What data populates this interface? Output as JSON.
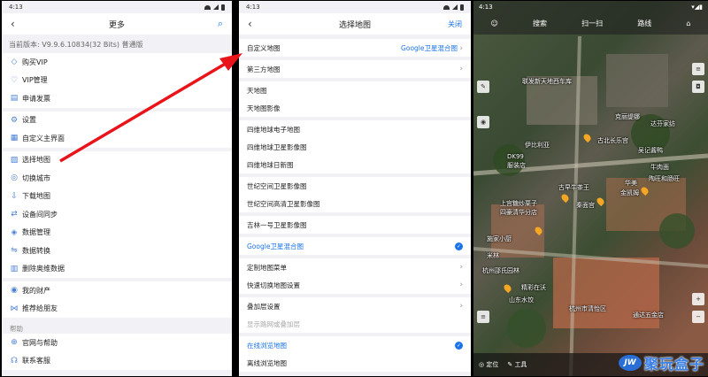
{
  "left": {
    "time": "4:13",
    "title": "更多",
    "version": "当前版本: V9.9.6.10834(32 Bits) 普通版",
    "group1": [
      "购买VIP",
      "VIP管理",
      "申请发票"
    ],
    "group2": [
      "设置",
      "自定义主界面"
    ],
    "group3": [
      "选择地图",
      "切换城市",
      "下载地图",
      "设备间同步",
      "数据管理",
      "数据转换",
      "删除奥维数据"
    ],
    "group4": [
      "我的财产",
      "推荐给朋友"
    ],
    "help_section": "帮助",
    "group5": [
      "官网与帮助",
      "联系客服"
    ]
  },
  "middle": {
    "time": "4:13",
    "title": "选择地图",
    "close": "关闭",
    "custom_map": "自定义地图",
    "custom_map_value": "Google卫星混合图",
    "third_party": "第三方地图",
    "tianditu": [
      "天地图",
      "天地图影像"
    ],
    "siwei": [
      "四维地球电子地图",
      "四维地球卫星影像图",
      "四维地球日新图"
    ],
    "shiji": [
      "世纪空间卫星影像图",
      "世纪空间高清卫星影像图"
    ],
    "jilin": "吉林一号卫星影像图",
    "google_hybrid": "Google卫星混合图",
    "custom_menu": "定制地图菜单",
    "quick_switch": "快速切换地图设置",
    "overlay": "叠加层设置",
    "show_overlay": "显示路网或叠加层",
    "online": "在线浏览地图",
    "offline": "离线浏览地图"
  },
  "right": {
    "time": "4:13",
    "tabs": [
      "搜索",
      "扫一扫",
      "路线"
    ],
    "labels": [
      "联发新天地西车库",
      "克丽缇娜",
      "达芬家纺",
      "伊比利亚",
      "古北长乐宫",
      "DK99",
      "服装店",
      "吴记酱鸭",
      "牛肉面",
      "陶旺和肠旺",
      "古早牛茶王",
      "华美",
      "金凯姆",
      "上宫糖炒栗子",
      "四豪清华分店",
      "秦面宫",
      "施家小厨",
      "米林",
      "杭州邵氏园林",
      "精彩在沃",
      "山东水饺",
      "杭州市清怡区",
      "通达五金店",
      "定位"
    ],
    "bottom": [
      "定位",
      "工具"
    ],
    "watermark_logo": "JW",
    "watermark_text": "聚玩盒子"
  }
}
